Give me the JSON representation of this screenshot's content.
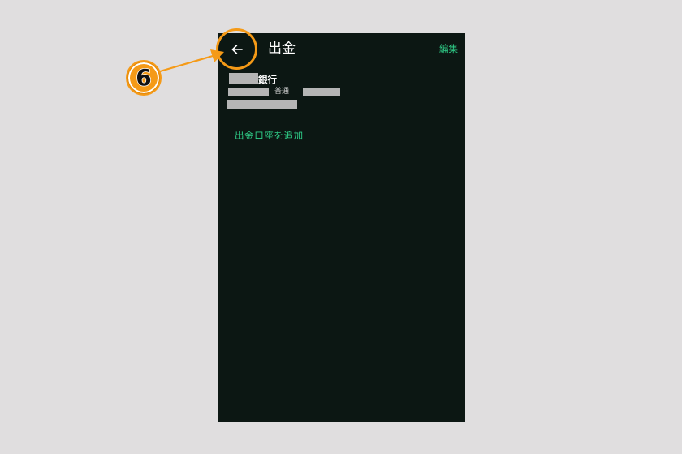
{
  "header": {
    "title": "出金",
    "edit_label": "編集",
    "back_icon": "arrow-left-icon"
  },
  "account": {
    "bank_name": "銀行",
    "account_type": "普通"
  },
  "add_account_label": "出金口座を追加",
  "annotation": {
    "step_number": "6",
    "color": "#f59a17"
  },
  "colors": {
    "background": "#e0dedf",
    "phone_background": "#0c1713",
    "accent": "#2fd08a",
    "redaction": "#b5b5b5"
  }
}
